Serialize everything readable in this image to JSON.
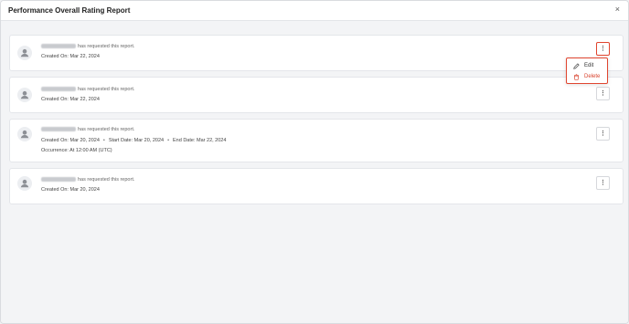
{
  "modal": {
    "title": "Performance Overall Rating Report",
    "close_icon": "×"
  },
  "reports": [
    {
      "requester": "Nagashree Test",
      "action": "has requested this report.",
      "created": "Created On: Mar 22, 2024"
    },
    {
      "requester": "Nagashree Test",
      "action": "has requested this report.",
      "created": "Created On: Mar 22, 2024"
    },
    {
      "requester": "Nagashree Test",
      "action": "has requested this report.",
      "created": "Created On: Mar 20, 2024",
      "start": "Start Date: Mar 20, 2024",
      "end": "End Date: Mar 22, 2024",
      "occurrence": "Occurrence: At 12:00 AM (UTC)"
    },
    {
      "requester": "Nagashree Test",
      "action": "has requested this report.",
      "created": "Created On: Mar 20, 2024"
    }
  ],
  "kebab_glyph": "⋮",
  "context_menu": {
    "edit_label": "Edit",
    "delete_label": "Delete"
  },
  "colors": {
    "highlight": "#e0452f",
    "delete": "#d9432e"
  }
}
